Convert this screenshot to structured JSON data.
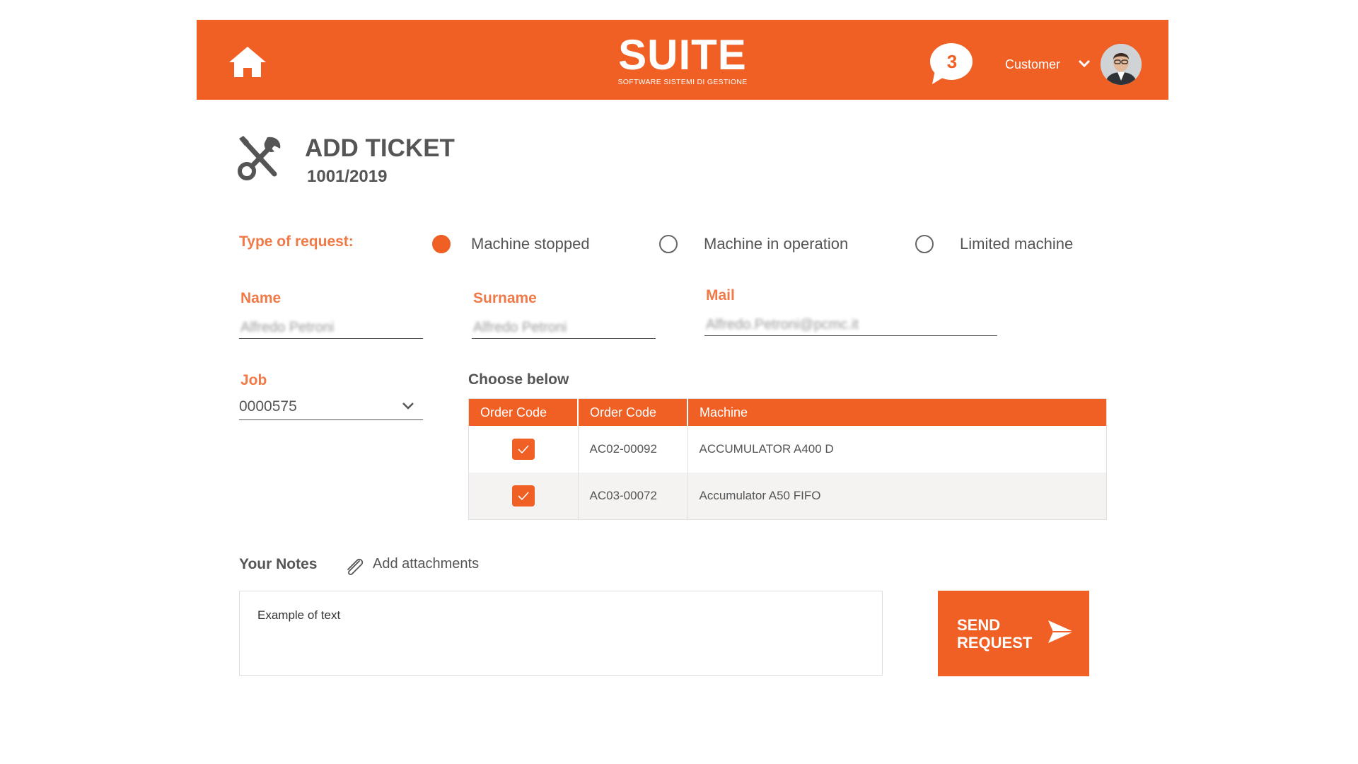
{
  "header": {
    "logo_title": "SUITE",
    "logo_subtitle": "SOFTWARE SISTEMI DI GESTIONE",
    "notification_count": "3",
    "user_label": "Customer",
    "icons": {
      "home": "home-icon",
      "chat": "chat-bubble-icon",
      "dropdown": "chevron-down-icon",
      "avatar": "avatar"
    },
    "brand_color": "#f05f24"
  },
  "page": {
    "title": "ADD TICKET",
    "ticket_number": "1001/2019",
    "icon": "tools-icon"
  },
  "request_type": {
    "label": "Type of request:",
    "options": [
      {
        "label": "Machine stopped",
        "selected": true
      },
      {
        "label": "Machine in operation",
        "selected": false
      },
      {
        "label": "Limited machine",
        "selected": false
      }
    ]
  },
  "form": {
    "name": {
      "label": "Name",
      "value": "Alfredo Petroni"
    },
    "surname": {
      "label": "Surname",
      "value": "Alfredo Petroni"
    },
    "mail": {
      "label": "Mail",
      "value": "Alfredo.Petroni@pcmc.it"
    },
    "job": {
      "label": "Job",
      "value": "0000575"
    }
  },
  "machines": {
    "heading": "Choose below",
    "columns": [
      "Order Code",
      "Order Code",
      "Machine"
    ],
    "rows": [
      {
        "checked": true,
        "order_code": "AC02-00092",
        "machine": "ACCUMULATOR A400 D"
      },
      {
        "checked": true,
        "order_code": "AC03-00072",
        "machine": "Accumulator A50 FIFO"
      }
    ]
  },
  "notes": {
    "label": "Your Notes",
    "attachments_label": "Add attachments",
    "text": "Example of text"
  },
  "send_button": {
    "label_line1": "SEND",
    "label_line2": "REQUEST",
    "icon": "send-icon"
  }
}
